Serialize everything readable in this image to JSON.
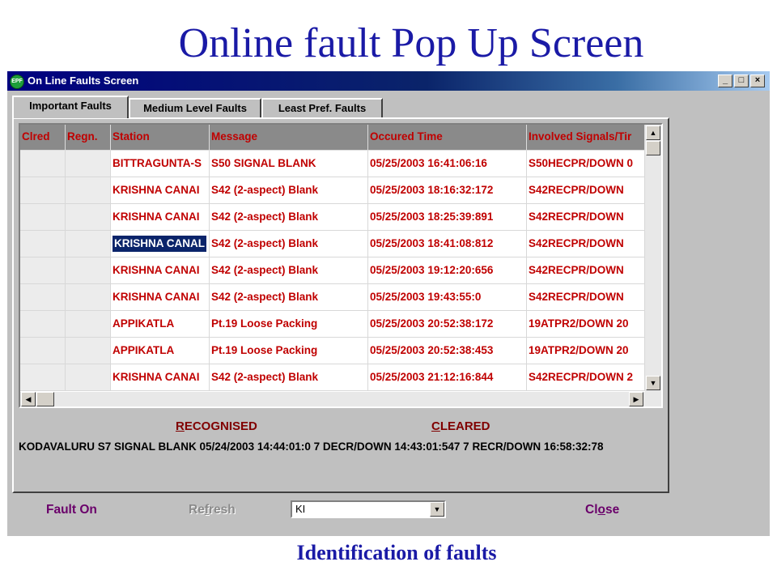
{
  "slide_title": "Online fault Pop Up Screen",
  "caption": "Identification of faults",
  "window": {
    "title": "On Line Faults Screen",
    "icon_text": "EPF",
    "controls": {
      "minimize": "_",
      "maximize": "□",
      "close": "×"
    }
  },
  "tabs": [
    {
      "label": "Important Faults",
      "active": true
    },
    {
      "label": "Medium Level Faults",
      "active": false
    },
    {
      "label": "Least Pref. Faults",
      "active": false
    }
  ],
  "grid": {
    "columns": [
      "Clred",
      "Regn.",
      "Station",
      "Message",
      "Occured Time",
      "Involved Signals/Tir"
    ],
    "rows": [
      [
        "",
        "",
        "BITTRAGUNTA-S",
        "S50 SIGNAL BLANK",
        "05/25/2003 16:41:06:16",
        "S50HECPR/DOWN 0"
      ],
      [
        "",
        "",
        "KRISHNA CANAI",
        "S42 (2-aspect) Blank",
        "05/25/2003 18:16:32:172",
        "S42RECPR/DOWN"
      ],
      [
        "",
        "",
        "KRISHNA CANAI",
        "S42 (2-aspect) Blank",
        "05/25/2003 18:25:39:891",
        "S42RECPR/DOWN"
      ],
      [
        "",
        "",
        "KRISHNA CANAL",
        "S42 (2-aspect) Blank",
        "05/25/2003 18:41:08:812",
        "S42RECPR/DOWN"
      ],
      [
        "",
        "",
        "KRISHNA CANAI",
        "S42 (2-aspect) Blank",
        "05/25/2003 19:12:20:656",
        "S42RECPR/DOWN"
      ],
      [
        "",
        "",
        "KRISHNA CANAI",
        "S42 (2-aspect) Blank",
        "05/25/2003 19:43:55:0",
        "S42RECPR/DOWN"
      ],
      [
        "",
        "",
        "APPIKATLA",
        "Pt.19 Loose Packing",
        "05/25/2003 20:52:38:172",
        "19ATPR2/DOWN 20"
      ],
      [
        "",
        "",
        "APPIKATLA",
        "Pt.19 Loose Packing",
        "05/25/2003 20:52:38:453",
        "19ATPR2/DOWN 20"
      ],
      [
        "",
        "",
        "KRISHNA CANAI",
        "S42 (2-aspect) Blank",
        "05/25/2003 21:12:16:844",
        "S42RECPR/DOWN 2"
      ]
    ],
    "selected_row": 3,
    "selected_col": 2
  },
  "status": {
    "recognised_key": "R",
    "recognised_rest": "ECOGNISED",
    "cleared_key": "C",
    "cleared_rest": "LEARED",
    "detail_text": "KODAVALURU S7 SIGNAL BLANK 05/24/2003 14:44:01:0 7 DECR/DOWN 14:43:01:547 7 RECR/DOWN 16:58:32:78"
  },
  "buttons": {
    "fault_on": "Fault On",
    "refresh_a": "Re",
    "refresh_key": "f",
    "refresh_b": "resh",
    "close_a": "Cl",
    "close_key": "o",
    "close_b": "se"
  },
  "combo": {
    "value": "KI"
  },
  "icons": {
    "scroll_up": "▲",
    "scroll_down": "▼",
    "scroll_left": "◀",
    "scroll_right": "▶",
    "dropdown": "▼"
  }
}
